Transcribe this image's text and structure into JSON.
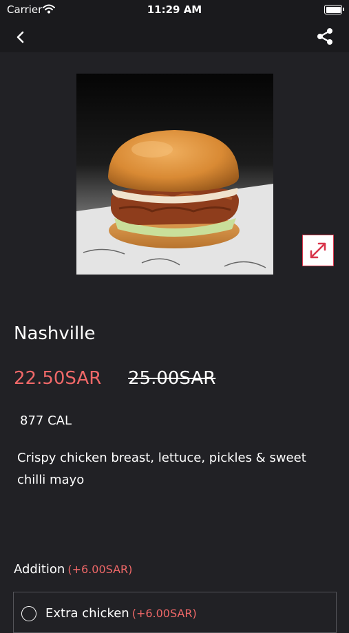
{
  "status_bar": {
    "carrier": "Carrier",
    "time": "11:29 AM",
    "battery_level": 1.0
  },
  "nav": {
    "back_icon": "chevron-left-icon",
    "share_icon": "share-icon"
  },
  "product": {
    "image": "chicken-burger-photo",
    "expand_icon": "expand-arrows-icon",
    "name": "Nashville",
    "price": "22.50SAR",
    "old_price": "25.00SAR",
    "calories": "877 CAL",
    "description": "Crispy chicken breast, lettuce, pickles & sweet chilli mayo"
  },
  "addition": {
    "title": "Addition",
    "extra": "(+6.00SAR)",
    "options": [
      {
        "label": "Extra chicken",
        "extra": "(+6.00SAR)",
        "selected": false
      }
    ]
  },
  "colors": {
    "background": "#212125",
    "bar": "#1a1a1d",
    "accent": "#ef6868",
    "expand_border": "#d9354b"
  }
}
